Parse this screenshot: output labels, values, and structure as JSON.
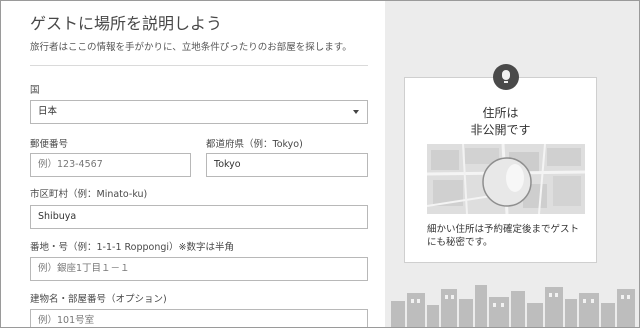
{
  "header": {
    "title": "ゲストに場所を説明しよう",
    "subtitle": "旅行者はここの情報を手がかりに、立地条件ぴったりのお部屋を探します。"
  },
  "form": {
    "country": {
      "label": "国",
      "value": "日本"
    },
    "postal": {
      "label": "郵便番号",
      "placeholder": "例）123-4567"
    },
    "prefecture": {
      "label": "都道府県（例：Tokyo)",
      "value": "Tokyo"
    },
    "city": {
      "label": "市区町村（例：Minato-ku)",
      "value": "Shibuya"
    },
    "street": {
      "label": "番地・号（例：1-1-1 Roppongi）※数字は半角",
      "placeholder": "例）銀座1丁目１－１"
    },
    "building": {
      "label": "建物名・部屋番号（オプション)",
      "placeholder": "例）101号室"
    }
  },
  "privacy_card": {
    "icon": "location-pin-icon",
    "title_line1": "住所は",
    "title_line2": "非公開です",
    "note": "細かい住所は予約確定後までゲストにも秘密です。"
  },
  "colors": {
    "accent_dark": "#4a4a4a",
    "panel_bg": "#ececec",
    "border": "#b8b8b8"
  }
}
